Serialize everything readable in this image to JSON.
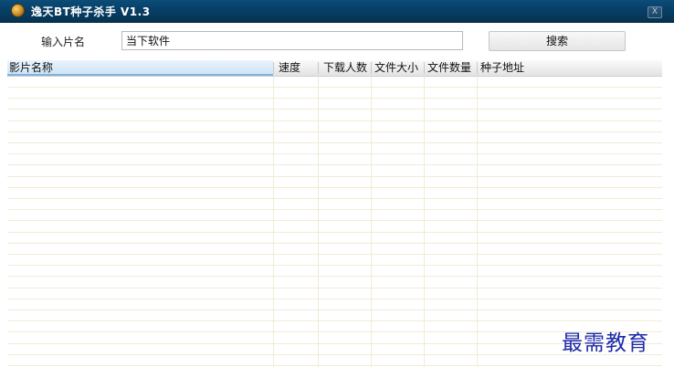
{
  "window": {
    "title": "逸天BT种子杀手 V1.3",
    "close_label": "X",
    "icon": "app-logo-icon"
  },
  "search": {
    "label": "输入片名",
    "value": "当下软件",
    "button_label": "搜索"
  },
  "table": {
    "columns": [
      "影片名称",
      "速度",
      "下载人数",
      "文件大小",
      "文件数量",
      "种子地址"
    ],
    "rows": []
  },
  "watermark": "最需教育",
  "colors": {
    "titlebar": "#083f66",
    "selected_header": "#cfe4f6",
    "row_line": "#f0ecd8",
    "watermark": "#1e2aa8"
  }
}
